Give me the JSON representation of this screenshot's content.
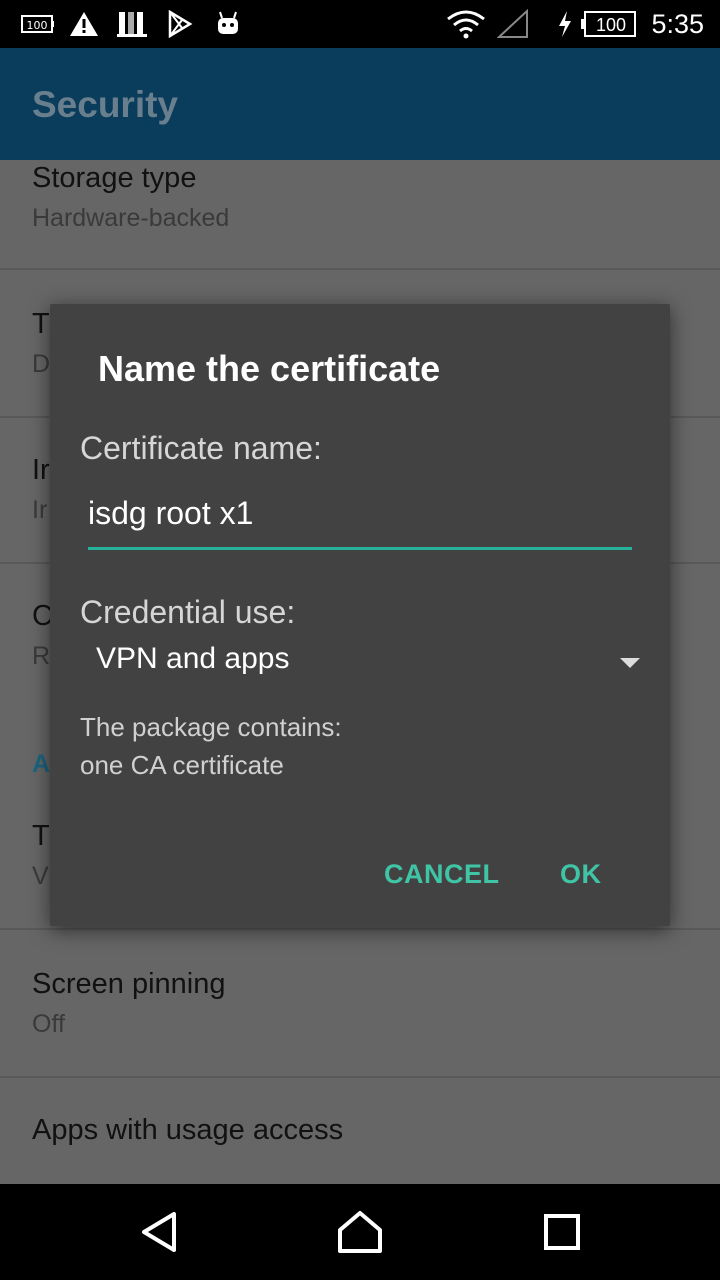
{
  "status_bar": {
    "time": "5:35",
    "battery_level": "100",
    "battery_level_left": "100",
    "icons": [
      "battery-small-icon",
      "warning-icon",
      "signal-bars-icon",
      "play-store-icon",
      "android-icon",
      "wifi-icon",
      "cell-signal-icon",
      "charging-icon",
      "battery-icon"
    ]
  },
  "app_bar": {
    "title": "Security"
  },
  "settings": {
    "storage_type": {
      "title": "Storage type",
      "summary": "Hardware-backed"
    },
    "item2": {
      "title": "T",
      "summary": "D"
    },
    "item3": {
      "title": "Ir",
      "summary": "Ir"
    },
    "item4": {
      "title": "C",
      "summary": "R"
    },
    "section_letter": "A",
    "item5": {
      "title": "T",
      "summary": "V"
    },
    "screen_pinning": {
      "title": "Screen pinning",
      "summary": "Off"
    },
    "usage_access": {
      "title": "Apps with usage access"
    }
  },
  "dialog": {
    "title": "Name the certificate",
    "cert_name_label": "Certificate name:",
    "cert_name_value": "isdg root x1",
    "credential_use_label": "Credential use:",
    "credential_use_value": "VPN and apps",
    "package_line1": "The package contains:",
    "package_line2": "one CA certificate",
    "cancel_label": "CANCEL",
    "ok_label": "OK"
  },
  "colors": {
    "accent": "#3fc5a5",
    "app_bar": "#0a3d5c",
    "dialog_bg": "#424242"
  }
}
